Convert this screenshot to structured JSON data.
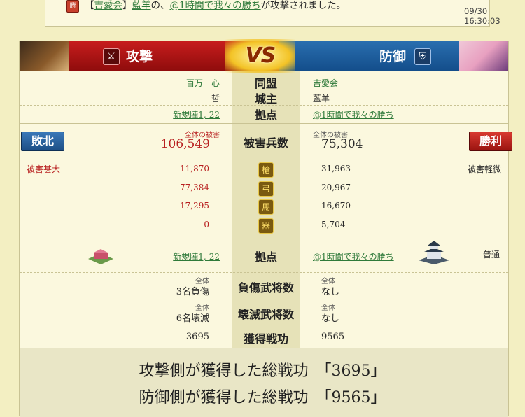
{
  "notice": {
    "badge": "勝",
    "prefix": "【",
    "alliance": "吉愛会",
    "suffix": "】",
    "actor": "藍羊",
    "mid1": "の、",
    "target": "@1時間で我々の勝ち",
    "tail": "が攻撃されました。",
    "time": "09/30 16:30:03"
  },
  "header": {
    "attack_label": "攻撃",
    "defense_label": "防御",
    "vs": "VS"
  },
  "info": {
    "alliance": {
      "label": "同盟",
      "attacker": "百万一心",
      "defender": "吉愛会"
    },
    "lord": {
      "label": "城主",
      "attacker": "哲",
      "defender": "藍羊"
    },
    "base": {
      "label": "拠点",
      "attacker": "新規陣1,-22",
      "defender": "@1時間で我々の勝ち"
    }
  },
  "damage": {
    "label": "被害兵数",
    "total_caption": "全体の被害",
    "attacker_total": "106,549",
    "defender_total": "75,304",
    "attacker_result": "敗北",
    "defender_result": "勝利",
    "attacker_severity": "被害甚大",
    "defender_severity": "被害軽微"
  },
  "units": [
    {
      "icon": "spearman-icon",
      "attacker": "11,870",
      "defender": "31,963"
    },
    {
      "icon": "archer-icon",
      "attacker": "77,384",
      "defender": "20,967"
    },
    {
      "icon": "cavalry-icon",
      "attacker": "17,295",
      "defender": "16,670"
    },
    {
      "icon": "siege-icon",
      "attacker": "0",
      "defender": "5,704"
    }
  ],
  "base_row": {
    "label": "拠点",
    "attacker": "新規陣1,-22",
    "defender": "@1時間で我々の勝ち",
    "defender_status": "普通"
  },
  "wounded": {
    "label": "負傷武将数",
    "caption": "全体",
    "attacker": "3名負傷",
    "defender": "なし"
  },
  "destroyed": {
    "label": "壊滅武将数",
    "caption": "全体",
    "attacker": "6名壊滅",
    "defender": "なし"
  },
  "merit": {
    "label": "獲得戦功",
    "attacker": "3695",
    "defender": "9565"
  },
  "footer": {
    "attacker_line": "攻撃側が獲得した総戦功　「3695」",
    "defender_line": "防御側が獲得した総戦功　「9565」"
  }
}
